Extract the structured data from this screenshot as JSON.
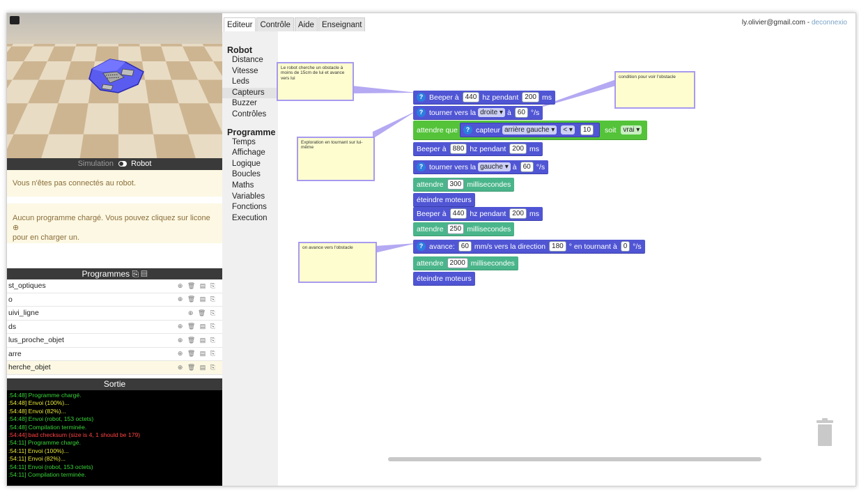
{
  "tabs": [
    "Editeur",
    "Contrôle",
    "Aide",
    "Enseignant"
  ],
  "user": {
    "email": "ly.olivier@gmail.com",
    "sep": " - ",
    "logout": "deconnexio"
  },
  "simulation": {
    "label": "Simulation",
    "robot_label": "Robot"
  },
  "messages": {
    "not_connected": "Vous n'êtes pas connectés au robot.",
    "no_program": "Aucun programme chargé. Vous pouvez cliquez sur licone",
    "no_program_2": "pour en charger un."
  },
  "programs": {
    "title": "Programmes",
    "items": [
      {
        "name": "st_optiques",
        "icons": "⊕ 🗑 ▤ ⎘",
        "selected": false
      },
      {
        "name": "o",
        "icons": "⊕ 🗑 ▤ ⎘",
        "selected": false
      },
      {
        "name": "uivi_ligne",
        "icons": "⊕ 🗑 ⎘",
        "selected": false
      },
      {
        "name": "ds",
        "icons": "⊕ 🗑 ▤ ⎘",
        "selected": false
      },
      {
        "name": "lus_proche_objet",
        "icons": "⊕ 🗑 ▤ ⎘",
        "selected": false
      },
      {
        "name": "arre",
        "icons": "⊕ 🗑 ▤ ⎘",
        "selected": false
      },
      {
        "name": "herche_objet",
        "icons": "⊕ 🗑 ▤ ⎘",
        "selected": true
      }
    ]
  },
  "output": {
    "title": "Sortie",
    "lines": [
      {
        "text": ":54:48] Programme chargé.",
        "color": "g"
      },
      {
        "text": ":54:48] Envoi (100%)...",
        "color": "y"
      },
      {
        "text": ":54:48] Envoi (82%)...",
        "color": "y"
      },
      {
        "text": ":54:48] Envoi (robot, 153 octets)",
        "color": "g"
      },
      {
        "text": ":54:48] Compilation terminée.",
        "color": "g"
      },
      {
        "text": ":54:44] bad checksum (size is 4, 1 should be 179)",
        "color": "r"
      },
      {
        "text": ":54:11] Programme chargé.",
        "color": "g"
      },
      {
        "text": ":54:11] Envoi (100%)...",
        "color": "y"
      },
      {
        "text": ":54:11] Envoi (82%)...",
        "color": "y"
      },
      {
        "text": ":54:11] Envoi (robot, 153 octets)",
        "color": "g"
      },
      {
        "text": ":54:11] Compilation terminée.",
        "color": "g"
      }
    ]
  },
  "categories": {
    "robot_title": "Robot",
    "robot_items": [
      "Distance",
      "Vitesse",
      "Leds",
      "Capteurs",
      "Buzzer",
      "Contrôles"
    ],
    "program_title": "Programme",
    "program_items": [
      "Temps",
      "Affichage",
      "Logique",
      "Boucles",
      "Maths",
      "Variables",
      "Fonctions",
      "Execution"
    ]
  },
  "comments": {
    "c1": "Le robot cherche un obstacle à moins de 15cm de lui et avance vers lui",
    "c2": "condition pour voir l'obstacle",
    "c3": "Exploration en tournant sur lui-même",
    "c4": "on avance vers l'obstacle"
  },
  "blocks": {
    "b1": {
      "t1": "Beeper à",
      "v1": "440",
      "t2": "hz pendant",
      "v2": "200",
      "t3": "ms"
    },
    "b2": {
      "t1": "tourner vers la",
      "dd": "droite ▾",
      "t2": "à",
      "v1": "60",
      "t3": "°/s"
    },
    "b3": {
      "t1": "attendre que",
      "t2": "capteur",
      "dd1": "arrière gauche ▾",
      "dd2": "< ▾",
      "v1": "10",
      "t3": "soit",
      "dd3": "vrai ▾"
    },
    "b4": {
      "t1": "Beeper à",
      "v1": "880",
      "t2": "hz pendant",
      "v2": "200",
      "t3": "ms"
    },
    "b5": {
      "t1": "tourner vers la",
      "dd": "gauche ▾",
      "t2": "à",
      "v1": "60",
      "t3": "°/s"
    },
    "b6": {
      "t1": "attendre",
      "v1": "300",
      "t2": "millisecondes"
    },
    "b7": {
      "t1": "éteindre moteurs"
    },
    "b8": {
      "t1": "Beeper à",
      "v1": "440",
      "t2": "hz pendant",
      "v2": "200",
      "t3": "ms"
    },
    "b9": {
      "t1": "attendre",
      "v1": "250",
      "t2": "millisecondes"
    },
    "b10": {
      "t1": "avance:",
      "v1": "60",
      "t2": "mm/s vers la direction",
      "v2": "180",
      "t3": "° en tournant à",
      "v3": "0",
      "t4": "°/s"
    },
    "b11": {
      "t1": "attendre",
      "v1": "2000",
      "t2": "millisecondes"
    },
    "b12": {
      "t1": "éteindre moteurs"
    }
  },
  "colors": {
    "block_blue": "#5055d4",
    "block_green": "#4ab58a",
    "block_lime": "#54c33a",
    "comment_border": "#a79af0"
  }
}
